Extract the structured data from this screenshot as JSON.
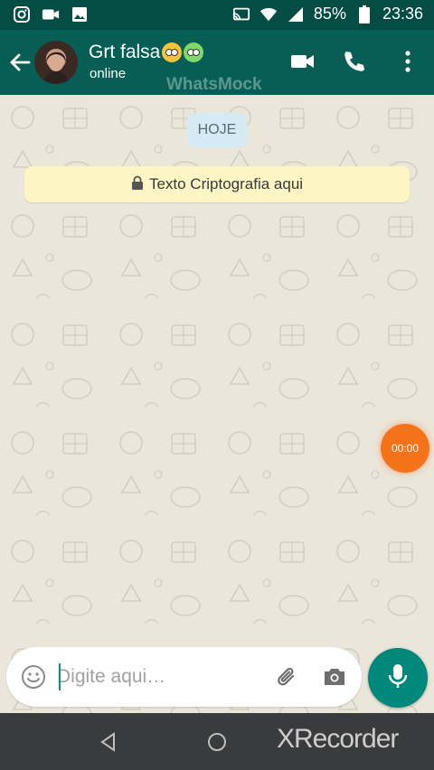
{
  "status_bar": {
    "battery": "85%",
    "time": "23:36",
    "icons": [
      "instagram-icon",
      "video-camera-icon",
      "gallery-icon",
      "cast-icon",
      "wifi-icon",
      "signal-icon",
      "battery-icon"
    ]
  },
  "header": {
    "contact_name": "Grt falsa",
    "contact_emojis": [
      "face-with-rolling-eyes",
      "nauseated-face"
    ],
    "status": "online",
    "watermark": "WhatsMock",
    "actions": [
      "video-call-icon",
      "voice-call-icon",
      "more-options-icon"
    ]
  },
  "chat": {
    "date_label": "HOJE",
    "encryption_note": "Texto Criptografia aqui",
    "timer_label": "00:00"
  },
  "composer": {
    "placeholder": "Digite aqui…",
    "value": ""
  },
  "nav": {
    "recorder_watermark": "XRecorder"
  },
  "colors": {
    "header": "#075e54",
    "status_bar": "#054d44",
    "accent": "#00897b",
    "timer": "#f4731a",
    "encryption_bg": "#fdf5c4",
    "date_chip_bg": "#d4eaf4"
  }
}
